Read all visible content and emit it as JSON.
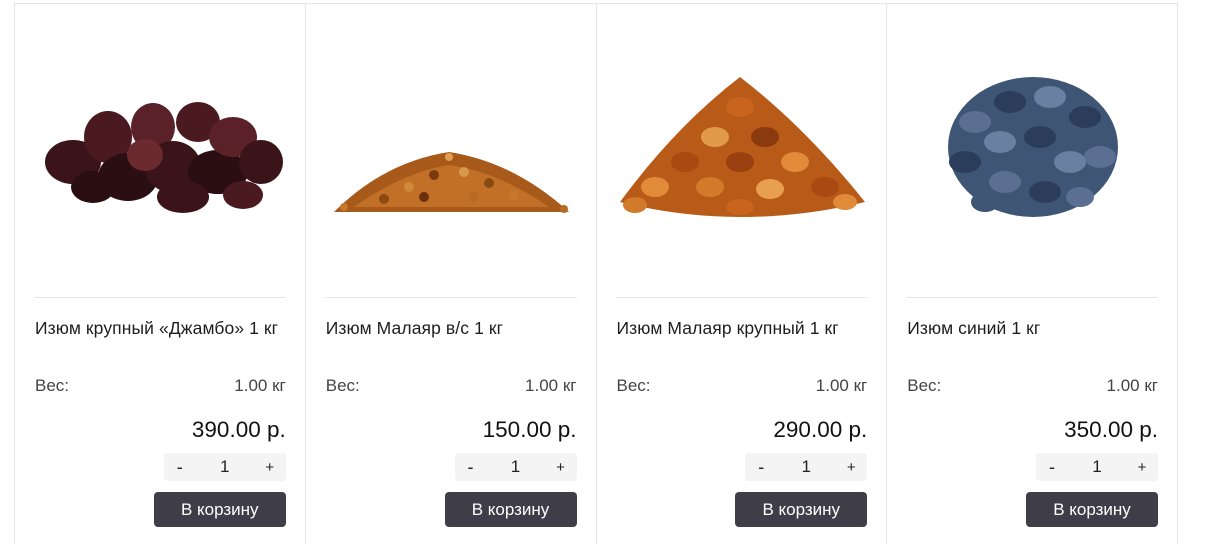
{
  "products": [
    {
      "title": "Изюм крупный «Джамбо» 1 кг",
      "weight_label": "Вес:",
      "weight_value": "1.00 кг",
      "price": "390.00 р.",
      "qty": "1",
      "minus": "-",
      "plus": "+",
      "cart_label": "В корзину",
      "image": "dark-raisins-image",
      "image_colors": [
        "#3a1418",
        "#5a2228",
        "#2a0e12"
      ]
    },
    {
      "title": "Изюм Малаяр в/с 1 кг",
      "weight_label": "Вес:",
      "weight_value": "1.00 кг",
      "price": "150.00 р.",
      "qty": "1",
      "minus": "-",
      "plus": "+",
      "cart_label": "В корзину",
      "image": "small-golden-raisins-image",
      "image_colors": [
        "#b5651d",
        "#8a4a12",
        "#d08a3a"
      ]
    },
    {
      "title": "Изюм Малаяр крупный 1 кг",
      "weight_label": "Вес:",
      "weight_value": "1.00 кг",
      "price": "290.00 р.",
      "qty": "1",
      "minus": "-",
      "plus": "+",
      "cart_label": "В корзину",
      "image": "large-golden-raisins-image",
      "image_colors": [
        "#c8641e",
        "#a84a12",
        "#e08a3a"
      ]
    },
    {
      "title": "Изюм синий 1 кг",
      "weight_label": "Вес:",
      "weight_value": "1.00 кг",
      "price": "350.00 р.",
      "qty": "1",
      "minus": "-",
      "plus": "+",
      "cart_label": "В корзину",
      "image": "blue-raisins-image",
      "image_colors": [
        "#3f5576",
        "#5a6f92",
        "#2b3d5a"
      ]
    }
  ],
  "theme": {
    "button_bg": "#3e3d48",
    "stepper_bg": "#f4f4f4",
    "border": "#e6e6e6"
  }
}
